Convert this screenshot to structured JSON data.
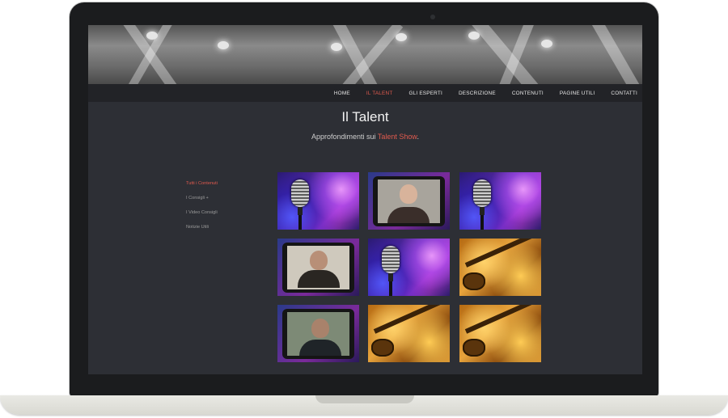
{
  "nav": {
    "items": [
      "HOME",
      "IL TALENT",
      "GLI ESPERTI",
      "DESCRIZIONE",
      "CONTENUTI",
      "PAGINE UTILI",
      "CONTATTI"
    ],
    "active_index": 1
  },
  "page": {
    "title": "Il Talent",
    "subtitle_prefix": "Approfondimenti sui ",
    "subtitle_highlight": "Talent Show",
    "subtitle_suffix": "."
  },
  "filters": {
    "items": [
      "Tutti i Contenuti",
      "I Consigli +",
      "I Video Consigli",
      "Notizie Utili"
    ],
    "active_index": 0
  },
  "gallery": {
    "tiles": [
      {
        "kind": "microphone"
      },
      {
        "kind": "video-woman"
      },
      {
        "kind": "microphone"
      },
      {
        "kind": "video-man-glasses"
      },
      {
        "kind": "microphone"
      },
      {
        "kind": "guitar-fire"
      },
      {
        "kind": "video-man"
      },
      {
        "kind": "guitar-fire"
      },
      {
        "kind": "guitar-fire"
      }
    ]
  },
  "colors": {
    "accent": "#e05a4e",
    "background": "#2d2f35",
    "navbar": "#222327"
  }
}
